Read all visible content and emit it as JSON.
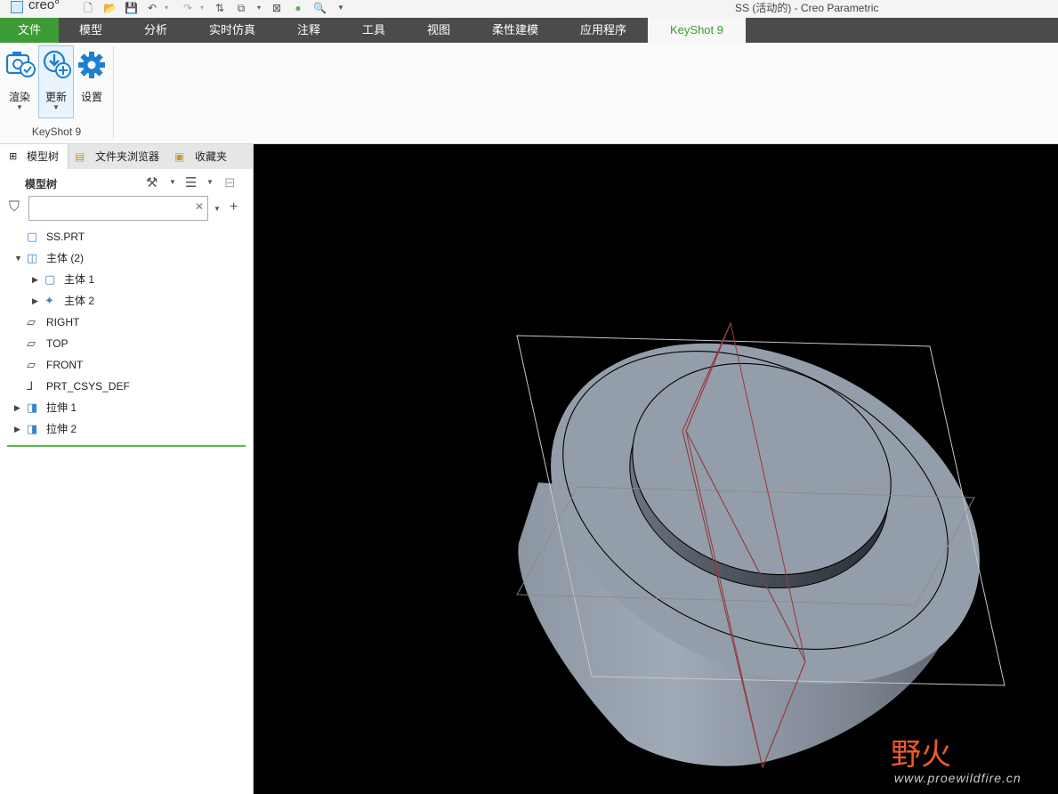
{
  "app": {
    "logo": "creo°",
    "window_title": "SS (活动的) - Creo Parametric"
  },
  "menu": {
    "tabs": [
      "文件",
      "模型",
      "分析",
      "实时仿真",
      "注释",
      "工具",
      "视图",
      "柔性建模",
      "应用程序",
      "KeyShot 9"
    ],
    "active": "KeyShot 9"
  },
  "ribbon": {
    "buttons": [
      {
        "label": "渲染",
        "icon": "camera-render-icon",
        "dropdown": true
      },
      {
        "label": "更新",
        "icon": "update-icon",
        "dropdown": true
      },
      {
        "label": "设置",
        "icon": "gear-icon",
        "dropdown": false
      }
    ],
    "group_label": "KeyShot 9"
  },
  "panel": {
    "tabs": [
      "模型树",
      "文件夹浏览器",
      "收藏夹"
    ],
    "tree_header": "模型树",
    "search_value": ""
  },
  "tree": [
    {
      "label": "SS.PRT",
      "icon": "part-icon",
      "indent": 0,
      "expander": "none"
    },
    {
      "label": "主体 (2)",
      "icon": "bodies-icon",
      "indent": 0,
      "expander": "expanded"
    },
    {
      "label": "主体 1",
      "icon": "body-icon",
      "indent": 1,
      "expander": "collapsed"
    },
    {
      "label": "主体 2",
      "icon": "body-star-icon",
      "indent": 1,
      "expander": "collapsed"
    },
    {
      "label": "RIGHT",
      "icon": "datum-plane-icon",
      "indent": 0,
      "expander": "none"
    },
    {
      "label": "TOP",
      "icon": "datum-plane-icon",
      "indent": 0,
      "expander": "none"
    },
    {
      "label": "FRONT",
      "icon": "datum-plane-icon",
      "indent": 0,
      "expander": "none"
    },
    {
      "label": "PRT_CSYS_DEF",
      "icon": "csys-icon",
      "indent": 0,
      "expander": "none"
    },
    {
      "label": "拉伸 1",
      "icon": "extrude-icon",
      "indent": 0,
      "expander": "collapsed"
    },
    {
      "label": "拉伸 2",
      "icon": "extrude-icon",
      "indent": 0,
      "expander": "collapsed"
    }
  ],
  "watermark": {
    "text": "野火",
    "url": "www.proewildfire.cn"
  },
  "colors": {
    "accent_green": "#3d9b35",
    "menubar": "#4b4b4b",
    "model_gray": "#949eab"
  }
}
